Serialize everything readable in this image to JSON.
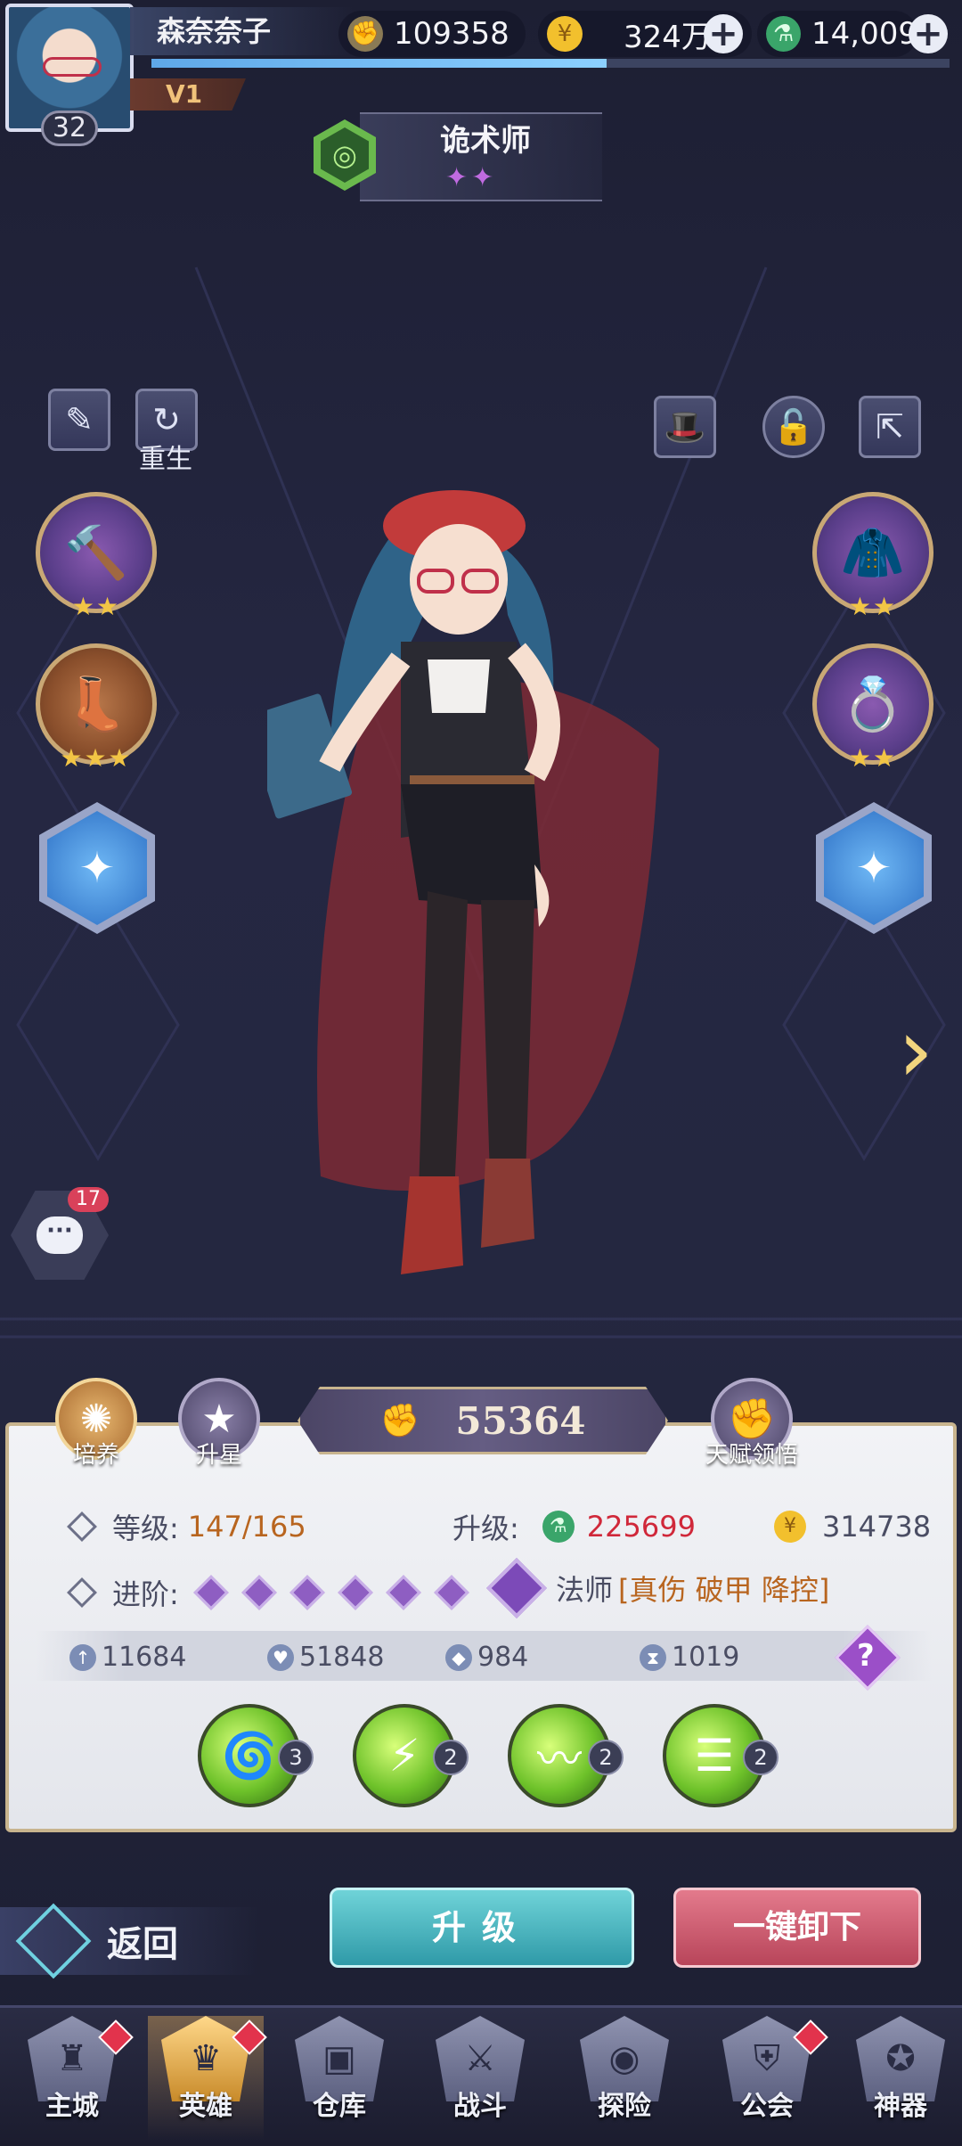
{
  "player": {
    "name": "森奈奈子",
    "vip": "V1",
    "level": "32",
    "exp_fraction": 0.57
  },
  "resources": {
    "power": "109358",
    "gold": "324万",
    "potion": "14,009"
  },
  "hero_class": {
    "name": "诡术师",
    "stars": "✦✦"
  },
  "side_buttons": {
    "rebirth_label": "重生"
  },
  "equipment": {
    "left": [
      {
        "name": "hammer",
        "stars": "★★"
      },
      {
        "name": "boots",
        "stars": "★★★"
      }
    ],
    "right": [
      {
        "name": "armor",
        "stars": "★★"
      },
      {
        "name": "ring",
        "stars": "★★"
      }
    ]
  },
  "chat": {
    "badge": "17"
  },
  "panel": {
    "tabs": {
      "train": "培养",
      "star_up": "升星",
      "talent": "天赋领悟"
    },
    "combat_power": "55364",
    "level_label": "等级:",
    "level_value": "147/165",
    "upgrade_label": "升级:",
    "upgrade_potion_cost": "225699",
    "upgrade_gold_cost": "314738",
    "advance_label": "进阶:",
    "advance_count": 6,
    "role": "法师",
    "role_tags": "[真伤 破甲 降控]",
    "stats": [
      {
        "icon": "attack-icon",
        "value": "11684"
      },
      {
        "icon": "hp-icon",
        "value": "51848"
      },
      {
        "icon": "defense-icon",
        "value": "984"
      },
      {
        "icon": "speed-icon",
        "value": "1019"
      }
    ],
    "skills": [
      {
        "level": "3"
      },
      {
        "level": "2"
      },
      {
        "level": "2"
      },
      {
        "level": "2"
      }
    ]
  },
  "actions": {
    "back": "返回",
    "upgrade": "升级",
    "unequip_all": "一键卸下"
  },
  "nav": [
    {
      "label": "主城",
      "dot": true
    },
    {
      "label": "英雄",
      "dot": true,
      "active": true
    },
    {
      "label": "仓库",
      "dot": false
    },
    {
      "label": "战斗",
      "dot": false
    },
    {
      "label": "探险",
      "dot": false
    },
    {
      "label": "公会",
      "dot": true
    },
    {
      "label": "神器",
      "dot": false
    }
  ],
  "colors": {
    "accent_gold": "#c8b48e",
    "upgrade_teal": "#2f9aa8",
    "unequip_pink": "#b8455a",
    "cost_red": "#d0283a",
    "level_orange": "#b8651f"
  }
}
